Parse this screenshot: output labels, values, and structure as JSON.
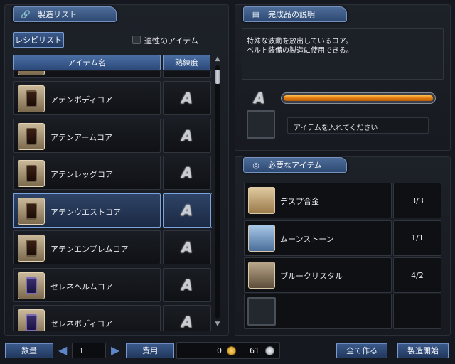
{
  "left_panel": {
    "title": "製造リスト",
    "recipe_tab": "レシピリスト",
    "fit_checkbox_label": "適性のアイテム"
  },
  "table": {
    "col_item": "アイテム名",
    "col_skill": "熟練度"
  },
  "items": [
    {
      "name": "アテンボディコア",
      "rank": "A",
      "icon": "orange-core"
    },
    {
      "name": "アテンアームコア",
      "rank": "A",
      "icon": "orange-core"
    },
    {
      "name": "アテンレッグコア",
      "rank": "A",
      "icon": "orange-core"
    },
    {
      "name": "アテンウエストコア",
      "rank": "A",
      "icon": "orange-core",
      "selected": true
    },
    {
      "name": "アテンエンブレムコア",
      "rank": "A",
      "icon": "orange-core"
    },
    {
      "name": "セレネヘルムコア",
      "rank": "A",
      "icon": "purple-core"
    },
    {
      "name": "セレネボディコア",
      "rank": "A",
      "icon": "purple-core"
    }
  ],
  "desc_panel": {
    "title": "完成品の説明",
    "text_line1": "特殊な波動を放出しているコア。",
    "text_line2": "ベルト装備の製造に使用できる。",
    "rank": "A",
    "progress_fraction": 1.0,
    "slot_hint": "アイテムを入れてください"
  },
  "required_panel": {
    "title": "必要なアイテム",
    "materials": [
      {
        "name": "デスプ合金",
        "count": "3/3"
      },
      {
        "name": "ムーンストーン",
        "count": "1/1"
      },
      {
        "name": "ブルークリスタル",
        "count": "4/2"
      }
    ]
  },
  "footer": {
    "qty_label": "数量",
    "qty_value": "1",
    "cost_label": "費用",
    "gold": "0",
    "silver": "61",
    "make_all": "全て作る",
    "start": "製造開始"
  },
  "colors": {
    "accent": "#3b5a8c",
    "progress": "#f0901c"
  }
}
